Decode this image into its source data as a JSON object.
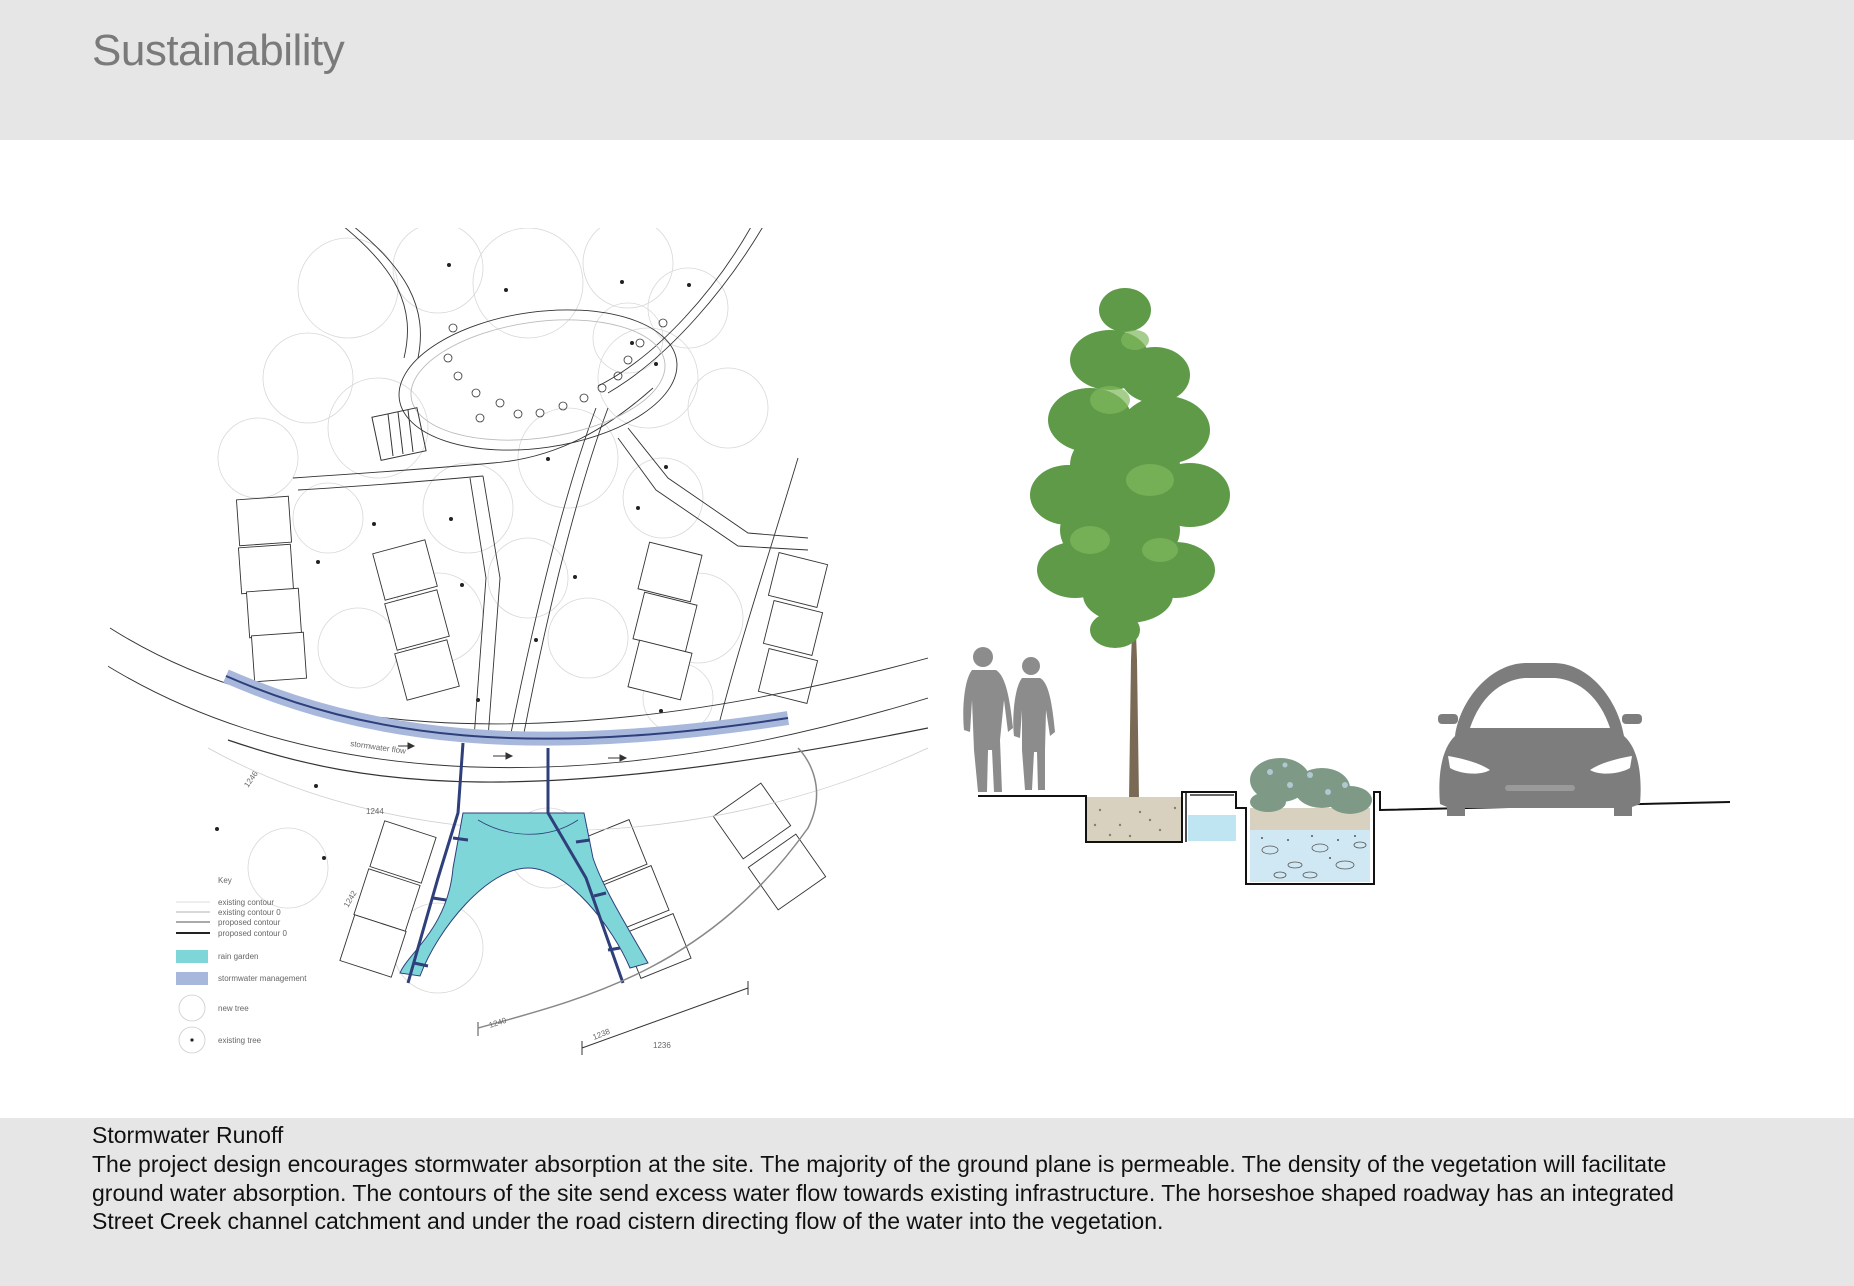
{
  "header": {
    "title": "Sustainability"
  },
  "plan": {
    "annotations": {
      "stormwater_flow": "stormwater flow",
      "contour_1244": "1244",
      "contour_1246": "1246",
      "contour_1242": "1242",
      "contour_1240": "1240",
      "contour_1238": "1238",
      "contour_1236": "1236"
    },
    "legend": {
      "title": "Key",
      "items": [
        {
          "label": "existing contour",
          "swatch": "thin-line"
        },
        {
          "label": "existing contour 0",
          "swatch": "thin-line"
        },
        {
          "label": "proposed contour",
          "swatch": "line"
        },
        {
          "label": "proposed contour 0",
          "swatch": "thick-line"
        },
        {
          "label": "rain garden",
          "swatch": "#7fd6d9"
        },
        {
          "label": "stormwater management",
          "swatch": "#a8b8dc"
        },
        {
          "label": "new tree",
          "swatch": "circle"
        },
        {
          "label": "existing tree",
          "swatch": "circle-dot"
        }
      ]
    },
    "colors": {
      "rain_garden": "#7fd6d9",
      "stormwater": "#a8b8dc",
      "pipe": "#2e3f7a"
    }
  },
  "section": {
    "icons": [
      "people-silhouette-icon",
      "tree-icon",
      "shrub-icon",
      "car-icon"
    ],
    "colors": {
      "silhouette": "#8c8c8c",
      "foliage": "#5e9a48",
      "water": "#bfe4f2"
    }
  },
  "caption": {
    "title": "Stormwater Runoff",
    "lines": [
      "The project design encourages stormwater absorption at the site.  The majority of the ground plane is permeable.  The density of the vegetation will facilitate",
      "ground water absorption.  The contours of the site send excess water flow towards existing infrastructure.  The horseshoe shaped roadway has an integrated",
      "Street Creek channel catchment and under the road cistern directing flow of the water into the vegetation."
    ]
  }
}
